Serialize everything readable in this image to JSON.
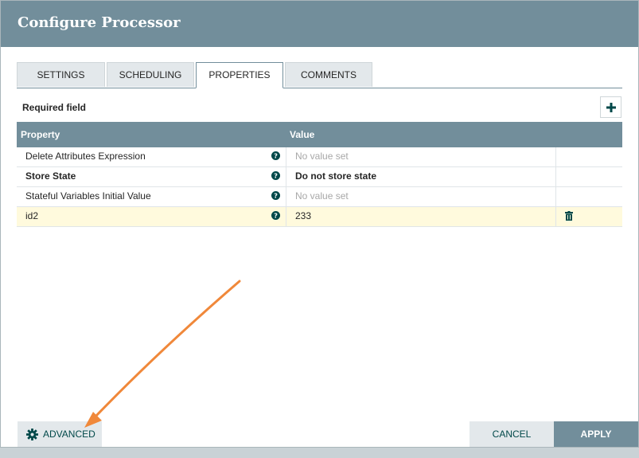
{
  "dialog": {
    "title": "Configure Processor"
  },
  "tabs": [
    {
      "label": "SETTINGS",
      "active": false
    },
    {
      "label": "SCHEDULING",
      "active": false
    },
    {
      "label": "PROPERTIES",
      "active": true
    },
    {
      "label": "COMMENTS",
      "active": false
    }
  ],
  "properties": {
    "required_label": "Required field",
    "columns": {
      "property": "Property",
      "value": "Value"
    },
    "rows": [
      {
        "name": "Delete Attributes Expression",
        "value": "No value set",
        "required": false,
        "empty": true
      },
      {
        "name": "Store State",
        "value": "Do not store state",
        "required": true,
        "empty": false
      },
      {
        "name": "Stateful Variables Initial Value",
        "value": "No value set",
        "required": false,
        "empty": true
      },
      {
        "name": "id2",
        "value": "233",
        "required": false,
        "empty": false,
        "highlighted": true,
        "deletable": true
      }
    ]
  },
  "footer": {
    "advanced_label": "ADVANCED",
    "cancel_label": "CANCEL",
    "apply_label": "APPLY"
  },
  "colors": {
    "header": "#728e9b",
    "accent": "#004849",
    "highlight_row": "#fffadd",
    "annotation_arrow": "#f0883a"
  },
  "icons": {
    "add": "plus-icon",
    "help": "question-circle-icon",
    "delete": "trash-icon",
    "advanced": "gear-icon"
  }
}
